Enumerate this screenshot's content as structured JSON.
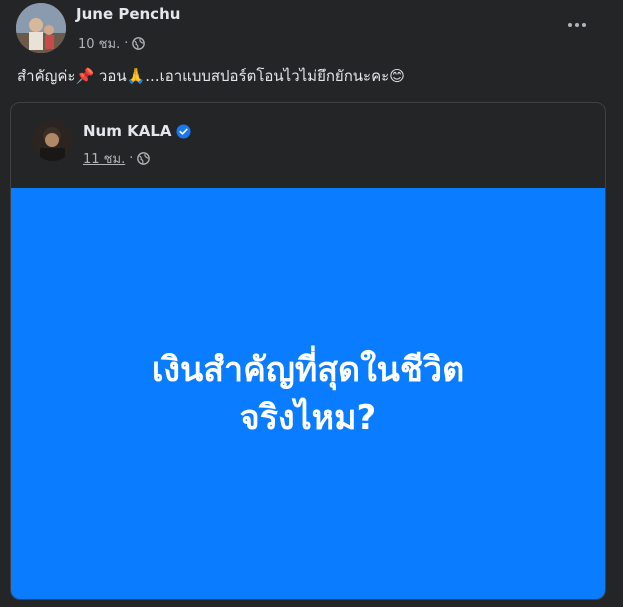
{
  "post": {
    "author_name": "June Penchu",
    "time": "10 ชม.",
    "separator": "·",
    "caption": "สำคัญค่ะ📌 วอน🙏...เอาแบบสปอร์ตโอนไวไม่ยึกยักนะคะ😊"
  },
  "shared": {
    "author_name": "Num KALA",
    "time": "11 ชม.",
    "separator": "·",
    "text_line1": "เงินสำคัญที่สุดในชีวิต",
    "text_line2": "จริงไหม?",
    "background_color": "#0a7cff"
  },
  "icons": {
    "globe": "globe-icon",
    "more": "more-options-icon",
    "verified": "verified-badge-icon"
  }
}
